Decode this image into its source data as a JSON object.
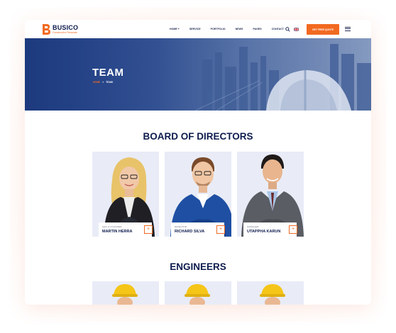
{
  "brand": {
    "name": "BUSICO",
    "tagline": "Construction Template",
    "accent": "#f26a21",
    "navy": "#0e1c4e"
  },
  "nav": {
    "items": [
      "HOME +",
      "SERVICE",
      "PORTFOLIO",
      "NEWS",
      "PAGES",
      "CONTACT"
    ],
    "search_icon": "search-icon",
    "flag_icon": "uk-flag-icon",
    "quote_label": "GET FREE QUOTE",
    "menu_icon": "hamburger-menu-icon"
  },
  "hero": {
    "title": "TEAM",
    "breadcrumb": {
      "home": "HOME",
      "separator": ">",
      "current": "TEAM"
    }
  },
  "board": {
    "title": "BOARD OF DIRECTORS",
    "members": [
      {
        "role": "CEO & FOUNDER",
        "name": "MARTIN HERRA"
      },
      {
        "role": "DIRECTOR",
        "name": "RICHARD SILVA"
      },
      {
        "role": "MANAGER",
        "name": "UTAPPHA KARUN"
      }
    ],
    "plus_label": "+"
  },
  "engineers": {
    "title": "ENGINEERS"
  }
}
